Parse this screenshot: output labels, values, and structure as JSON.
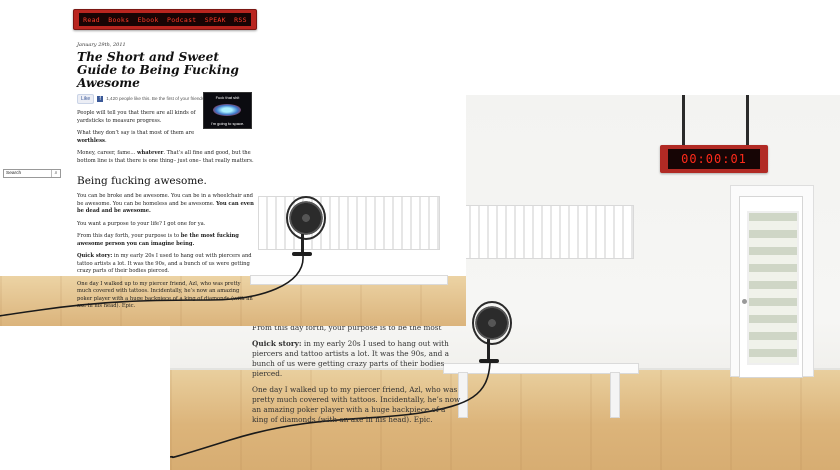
{
  "front": {
    "nav_items": [
      "Read",
      "Books",
      "Ebook",
      "Podcast",
      "SPEAK",
      "RSS"
    ],
    "post": {
      "date": "January 29th, 2011",
      "title": "The Short and Sweet Guide to Being Fucking Awesome",
      "like_label": "Like",
      "like_text": "1,420 people like this. Be the first of your friends.",
      "p1": "People will tell you that there are all kinds of yardsticks to measure progress.",
      "p2_lead": "What they don’t say is that most of them are ",
      "p2_bold": "worthless",
      "p2_end": ".",
      "p3_lead": "Money, career, fame… ",
      "p3_bold": "whatever",
      "p3_end": ". That’s all fine and good, but the bottom line is that there is one thing– just one– that really matters.",
      "heading": "Being fucking awesome.",
      "p4_lead": "You can be broke and be awesome. You can be in a wheelchair and be awesome. You can be homeless and be awesome. ",
      "p4_bold": "You can even be dead and be awesome.",
      "p5": "You want a purpose to your life? I got one for ya.",
      "p6_lead": "From this day forth, your purpose is to ",
      "p6_bold": "be the most fucking awesome person you can imagine being.",
      "p7_bold": "Quick story:",
      "p7": " in my early 20s I used to hang out with piercers and tattoo artists a lot. It was the 90s, and a bunch of us were getting crazy parts of their bodies pierced.",
      "p8": "One day I walked up to my piercer friend, Azl, who was pretty much covered with tattoos. Incidentally, he’s now an amazing poker player with a huge backpiece of a king of diamonds (with an axe in his head). Epic."
    },
    "thumb": {
      "top_caption": "Fuck that shit",
      "bottom_caption": "I’m going to space."
    },
    "search": {
      "placeholder": "Search",
      "button_icon": "magnifier-icon"
    }
  },
  "back": {
    "clock_value": "00:00:01",
    "partial_heading": "From this day forth, your purpose is to be the most fucking awesome person you can imagine being.",
    "p1_bold": "Quick story:",
    "p1": " in my early 20s I used to hang out with piercers and tattoo artists a lot. It was the 90s, and a bunch of us were getting crazy parts of their bodies pierced.",
    "p2": "One day I walked up to my piercer friend, Azl, who was pretty much covered with tattoos. Incidentally, he’s now an amazing poker player with a huge backpiece of a king of diamonds (with an axe in his head). Epic."
  },
  "colors": {
    "nav_red": "#b9251f",
    "led_red": "#ff2a1a",
    "floor": "#dbb47c"
  }
}
